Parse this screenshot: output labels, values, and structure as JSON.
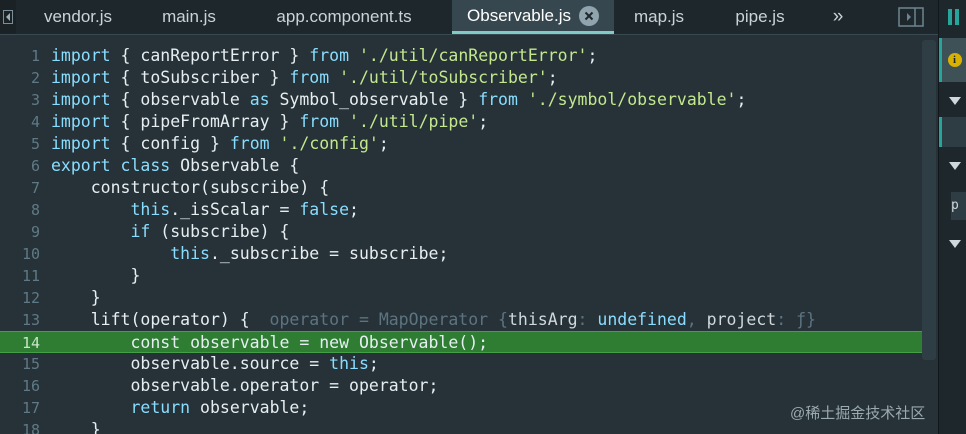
{
  "tabs": [
    {
      "label": "vendor.js",
      "active": false
    },
    {
      "label": "main.js",
      "active": false
    },
    {
      "label": "app.component.ts",
      "active": false
    },
    {
      "label": "Observable.js",
      "active": true
    },
    {
      "label": "map.js",
      "active": false
    },
    {
      "label": "pipe.js",
      "active": false
    }
  ],
  "tab_overflow": "»",
  "side_panel": {
    "info_glyph": "i",
    "partial_text": "p"
  },
  "editor": {
    "highlighted_line": 14,
    "lines": [
      {
        "n": "1",
        "tokens": [
          [
            "k",
            "import"
          ],
          [
            "p",
            " { canReportError } "
          ],
          [
            "k",
            "from"
          ],
          [
            "p",
            " "
          ],
          [
            "s",
            "'./util/canReportError'"
          ],
          [
            "p",
            ";"
          ]
        ]
      },
      {
        "n": "2",
        "tokens": [
          [
            "k",
            "import"
          ],
          [
            "p",
            " { toSubscriber } "
          ],
          [
            "k",
            "from"
          ],
          [
            "p",
            " "
          ],
          [
            "s",
            "'./util/toSubscriber'"
          ],
          [
            "p",
            ";"
          ]
        ]
      },
      {
        "n": "3",
        "tokens": [
          [
            "k",
            "import"
          ],
          [
            "p",
            " { observable "
          ],
          [
            "k",
            "as"
          ],
          [
            "p",
            " Symbol_observable } "
          ],
          [
            "k",
            "from"
          ],
          [
            "p",
            " "
          ],
          [
            "s",
            "'./symbol/observable'"
          ],
          [
            "p",
            ";"
          ]
        ]
      },
      {
        "n": "4",
        "tokens": [
          [
            "k",
            "import"
          ],
          [
            "p",
            " { pipeFromArray } "
          ],
          [
            "k",
            "from"
          ],
          [
            "p",
            " "
          ],
          [
            "s",
            "'./util/pipe'"
          ],
          [
            "p",
            ";"
          ]
        ]
      },
      {
        "n": "5",
        "tokens": [
          [
            "k",
            "import"
          ],
          [
            "p",
            " { config } "
          ],
          [
            "k",
            "from"
          ],
          [
            "p",
            " "
          ],
          [
            "s",
            "'./config'"
          ],
          [
            "p",
            ";"
          ]
        ]
      },
      {
        "n": "6",
        "tokens": [
          [
            "k",
            "export"
          ],
          [
            "p",
            " "
          ],
          [
            "k",
            "class"
          ],
          [
            "p",
            " Observable {"
          ]
        ]
      },
      {
        "n": "7",
        "tokens": [
          [
            "p",
            "    constructor(subscribe) {"
          ]
        ]
      },
      {
        "n": "8",
        "tokens": [
          [
            "p",
            "        "
          ],
          [
            "k",
            "this"
          ],
          [
            "p",
            "._isScalar = "
          ],
          [
            "k",
            "false"
          ],
          [
            "p",
            ";"
          ]
        ]
      },
      {
        "n": "9",
        "tokens": [
          [
            "p",
            "        "
          ],
          [
            "k",
            "if"
          ],
          [
            "p",
            " (subscribe) {"
          ]
        ]
      },
      {
        "n": "10",
        "tokens": [
          [
            "p",
            "            "
          ],
          [
            "k",
            "this"
          ],
          [
            "p",
            "._subscribe = subscribe;"
          ]
        ]
      },
      {
        "n": "11",
        "tokens": [
          [
            "p",
            "        }"
          ]
        ]
      },
      {
        "n": "12",
        "tokens": [
          [
            "p",
            "    }"
          ]
        ]
      },
      {
        "n": "13",
        "tokens": [
          [
            "p",
            "    lift(operator) {  "
          ],
          [
            "inlay",
            "operator = MapOperator {"
          ],
          [
            "inlay-v",
            "thisArg"
          ],
          [
            "inlay",
            ": "
          ],
          [
            "inlay-u",
            "undefined"
          ],
          [
            "inlay",
            ", "
          ],
          [
            "inlay-v",
            "project"
          ],
          [
            "inlay",
            ": ƒ}"
          ]
        ]
      },
      {
        "n": "14",
        "tokens": [
          [
            "p",
            "        const observable = new Observable();"
          ]
        ]
      },
      {
        "n": "15",
        "tokens": [
          [
            "p",
            "        observable.source = "
          ],
          [
            "k",
            "this"
          ],
          [
            "p",
            ";"
          ]
        ]
      },
      {
        "n": "16",
        "tokens": [
          [
            "p",
            "        observable.operator = operator;"
          ]
        ]
      },
      {
        "n": "17",
        "tokens": [
          [
            "p",
            "        "
          ],
          [
            "k",
            "return"
          ],
          [
            "p",
            " observable;"
          ]
        ]
      },
      {
        "n": "18",
        "tokens": [
          [
            "p",
            "    }"
          ]
        ]
      }
    ]
  },
  "watermark": "@稀土掘金技术社区",
  "colors": {
    "accent": "#80cbc4",
    "highlight": "#2e7d32",
    "keyword": "#89ddff",
    "string": "#c3e88d"
  }
}
